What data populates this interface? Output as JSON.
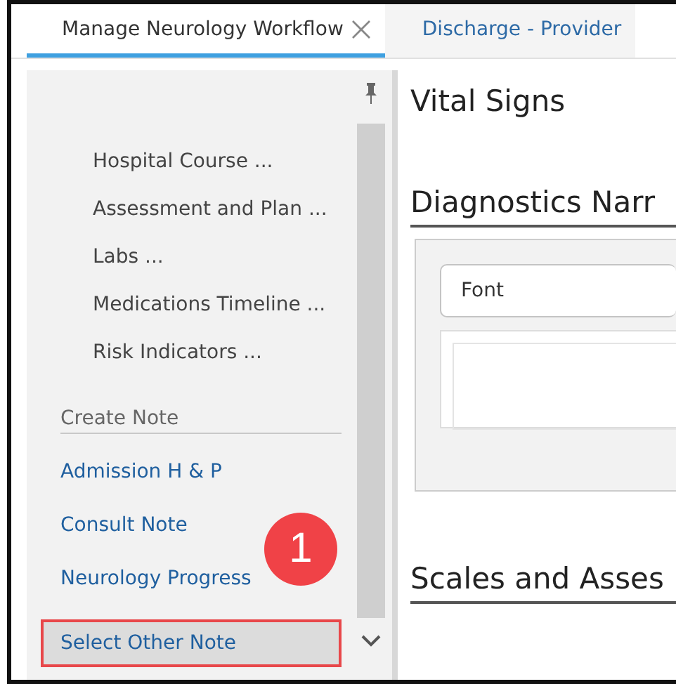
{
  "tabs": [
    {
      "label": "Manage Neurology Workflow",
      "selected": true,
      "closable": true
    },
    {
      "label": "Discharge - Provider",
      "selected": false,
      "closable": false
    }
  ],
  "sidebar": {
    "sections": [
      {
        "kind": "links",
        "items": [
          {
            "label": "Hospital Course ..."
          },
          {
            "label": "Assessment and Plan ..."
          },
          {
            "label": "Labs ..."
          },
          {
            "label": "Medications Timeline ..."
          },
          {
            "label": "Risk Indicators ..."
          }
        ]
      },
      {
        "kind": "notes",
        "heading": "Create Note",
        "items": [
          {
            "label": "Admission H & P",
            "highlighted": false
          },
          {
            "label": "Consult Note",
            "highlighted": false
          },
          {
            "label": "Neurology Progress",
            "highlighted": false
          },
          {
            "label": "Select Other Note",
            "highlighted": true
          }
        ]
      }
    ]
  },
  "callout": {
    "number": "1"
  },
  "content": {
    "sections": [
      {
        "title": "Vital Signs",
        "underline": false
      },
      {
        "title": "Diagnostics Narr",
        "underline": true,
        "editor": {
          "font_placeholder": "Font"
        }
      },
      {
        "title": "Scales and Asses",
        "underline": true
      }
    ]
  }
}
